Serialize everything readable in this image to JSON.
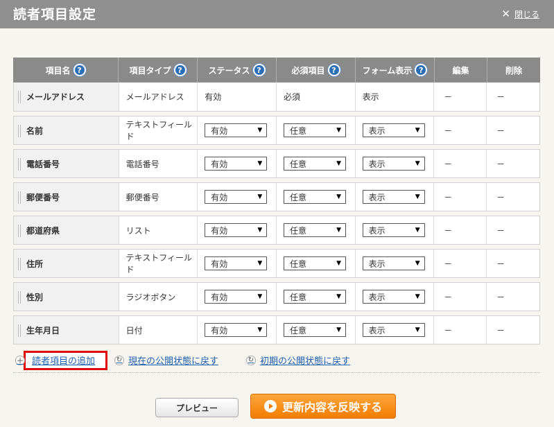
{
  "window": {
    "title": "読者項目設定",
    "close_label": "閉じる"
  },
  "table": {
    "headers": [
      "項目名",
      "項目タイプ",
      "ステータス",
      "必須項目",
      "フォーム表示",
      "編集",
      "削除"
    ],
    "help_mark": "?",
    "fixed_row": {
      "name": "メールアドレス",
      "type": "メールアドレス",
      "status": "有効",
      "required": "必須",
      "display": "表示",
      "edit": "－",
      "delete": "－"
    },
    "rows": [
      {
        "name": "名前",
        "type": "テキストフィールド",
        "status": "有効",
        "required": "任意",
        "display": "表示",
        "edit": "－",
        "delete": "－"
      },
      {
        "name": "電話番号",
        "type": "電話番号",
        "status": "有効",
        "required": "任意",
        "display": "表示",
        "edit": "－",
        "delete": "－"
      },
      {
        "name": "郵便番号",
        "type": "郵便番号",
        "status": "有効",
        "required": "任意",
        "display": "表示",
        "edit": "－",
        "delete": "－"
      },
      {
        "name": "都道府県",
        "type": "リスト",
        "status": "有効",
        "required": "任意",
        "display": "表示",
        "edit": "－",
        "delete": "－"
      },
      {
        "name": "住所",
        "type": "テキストフィールド",
        "status": "有効",
        "required": "任意",
        "display": "表示",
        "edit": "－",
        "delete": "－"
      },
      {
        "name": "性別",
        "type": "ラジオボタン",
        "status": "有効",
        "required": "任意",
        "display": "表示",
        "edit": "－",
        "delete": "－"
      },
      {
        "name": "生年月日",
        "type": "日付",
        "status": "有効",
        "required": "任意",
        "display": "表示",
        "edit": "－",
        "delete": "－"
      }
    ]
  },
  "links": {
    "add": "読者項目の追加",
    "reset_current": "現在の公開状態に戻す",
    "reset_initial": "初期の公開状態に戻す"
  },
  "buttons": {
    "preview": "プレビュー",
    "update": "更新内容を反映する"
  },
  "colors": {
    "title_bar": "#8f8f8f",
    "header": "#8a8a8a",
    "help_icon": "#2d6fb5",
    "highlight_box": "#e00000",
    "update_button": "#f07d00"
  }
}
